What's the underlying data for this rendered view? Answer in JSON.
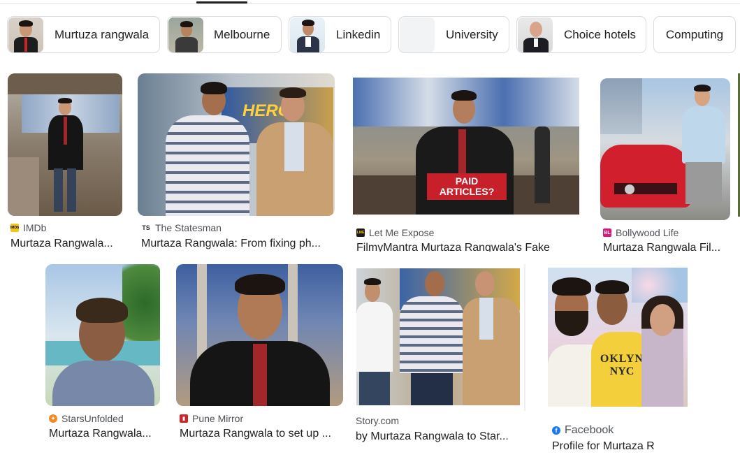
{
  "chips": [
    {
      "label": "Murtuza rangwala"
    },
    {
      "label": "Melbourne"
    },
    {
      "label": "Linkedin"
    },
    {
      "label": "University"
    },
    {
      "label": "Choice hotels"
    },
    {
      "label": "Computing"
    }
  ],
  "results": [
    {
      "source": "IMDb",
      "title": "Murtaza Rangwala..."
    },
    {
      "source": "The Statesman",
      "title": "Murtaza Rangwala: From fixing ph..."
    },
    {
      "source": "Let Me Expose",
      "title": "FilmyMantra Murtaza Rangwala's Fake"
    },
    {
      "source": "Bollywood Life",
      "title": "Murtaza Rangwala Fil..."
    },
    {
      "source": "StarsUnfolded",
      "title": "Murtaza Rangwala..."
    },
    {
      "source": "Pune Mirror",
      "title": "Murtaza Rangwala to set up ..."
    },
    {
      "source": "Story.com",
      "title": "by Murtaza Rangwala to Star..."
    },
    {
      "source": "Facebook",
      "title": "Profile for Murtaza R"
    }
  ],
  "image_text": {
    "paid_articles_line1": "PAID",
    "paid_articles_line2": "ARTICLES?",
    "poster_text": "HERO",
    "shirt_text": "OKLYN",
    "shirt_text2": "NYC"
  },
  "favicons": {
    "imdb": "IMDb",
    "statesman": "TS",
    "letmeexpose": "LME",
    "bollywood": "BL"
  },
  "colors": {
    "imdb": "#f5c518",
    "lme": "#1a1a1a",
    "bollywood": "#e4147a",
    "stars": "#f08a24",
    "pune": "#d2232a",
    "facebook": "#1877f2",
    "paid_banner": "#c8202a"
  }
}
